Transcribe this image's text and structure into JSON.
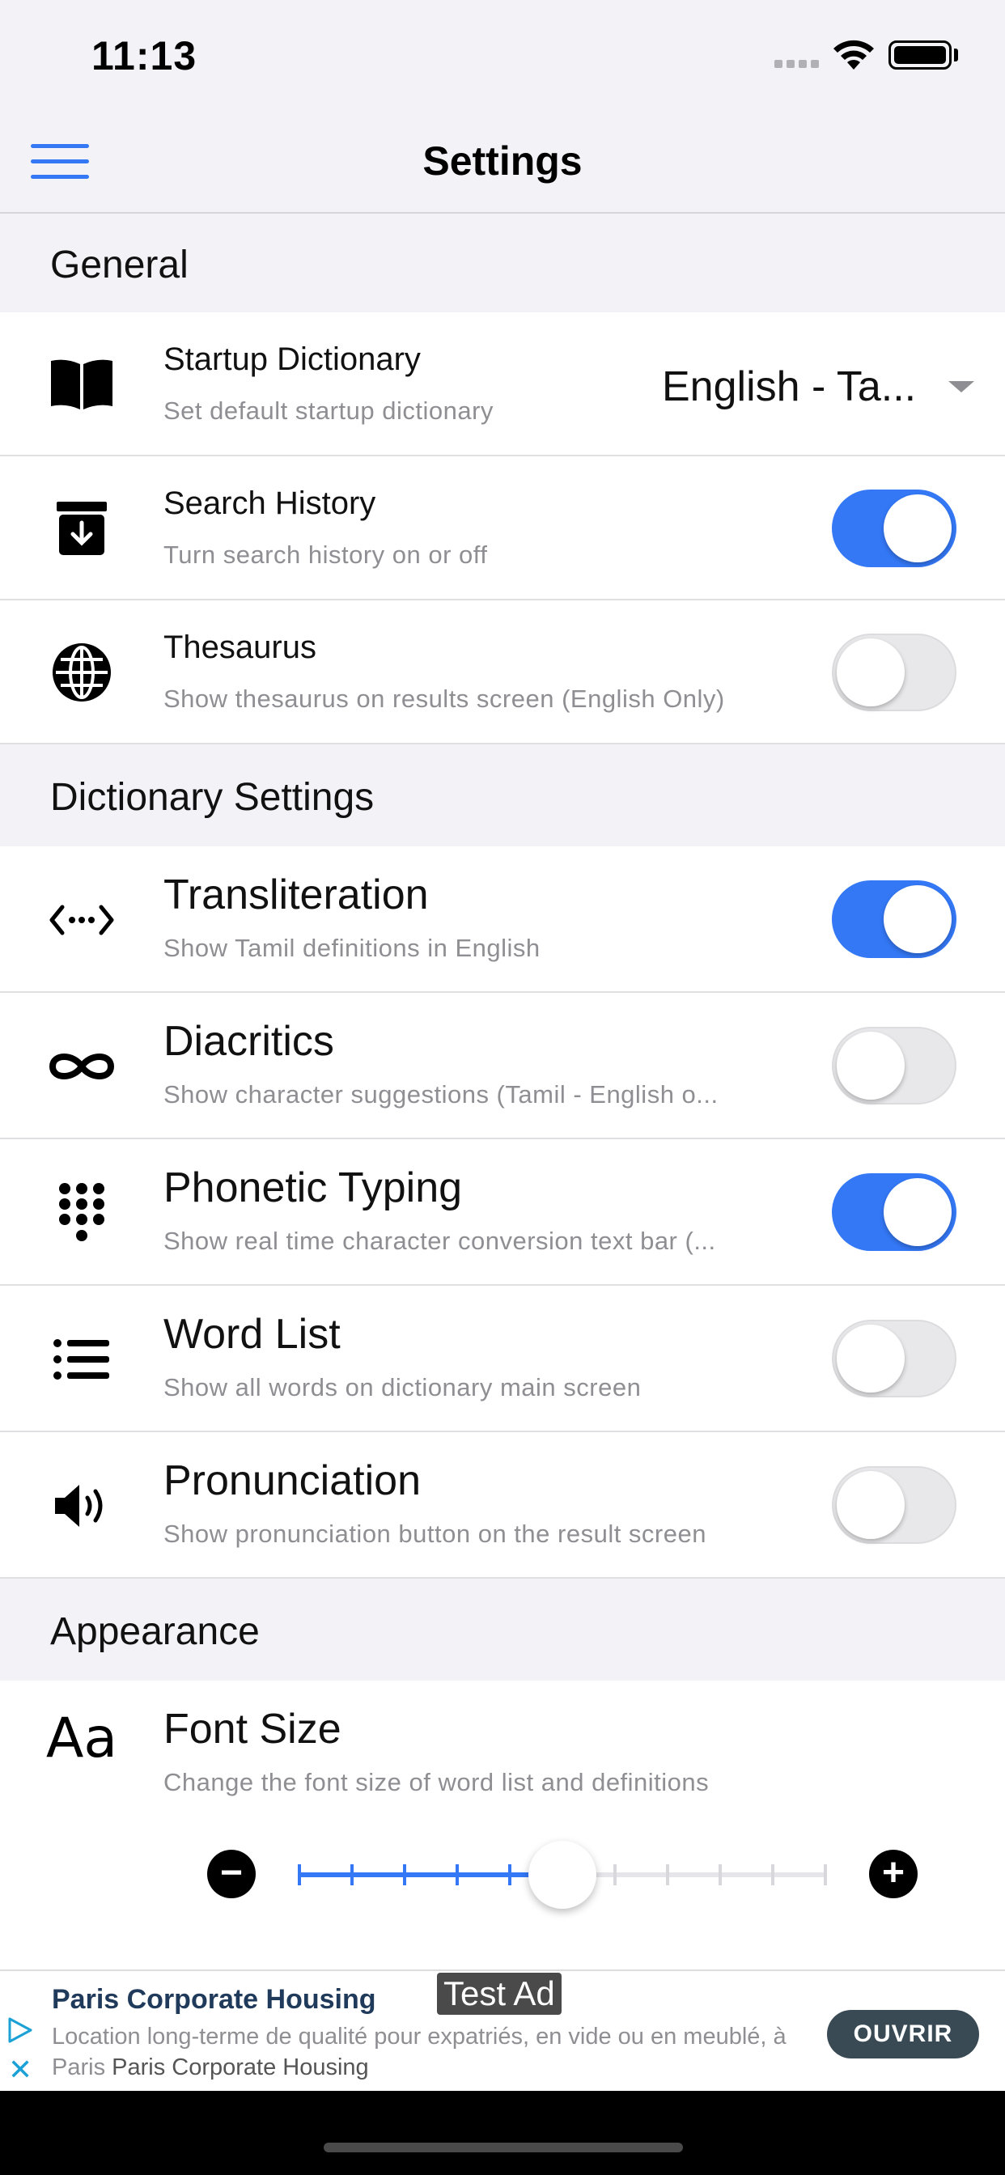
{
  "status_bar": {
    "time": "11:13"
  },
  "nav": {
    "title": "Settings"
  },
  "sections": {
    "general": "General",
    "dictionary": "Dictionary Settings",
    "appearance": "Appearance"
  },
  "general": {
    "startup": {
      "title": "Startup Dictionary",
      "subtitle": "Set default startup dictionary",
      "value": "English - Ta..."
    },
    "history": {
      "title": "Search History",
      "subtitle": "Turn search history on or off",
      "enabled": true
    },
    "thesaurus": {
      "title": "Thesaurus",
      "subtitle": "Show thesaurus on results screen (English Only)",
      "enabled": false
    }
  },
  "dictionary": {
    "transliteration": {
      "title": "Transliteration",
      "subtitle": "Show Tamil definitions in English",
      "enabled": true
    },
    "diacritics": {
      "title": "Diacritics",
      "subtitle": "Show character suggestions (Tamil - English o...",
      "enabled": false
    },
    "phonetic": {
      "title": "Phonetic Typing",
      "subtitle": "Show real time character conversion text bar (...",
      "enabled": true
    },
    "wordlist": {
      "title": "Word List",
      "subtitle": "Show all words on dictionary main screen",
      "enabled": false
    },
    "pronunciation": {
      "title": "Pronunciation",
      "subtitle": "Show pronunciation button on the result screen",
      "enabled": false
    }
  },
  "appearance": {
    "font_size": {
      "title": "Font Size",
      "subtitle": "Change the font size of word list and definitions",
      "icon_text": "Aa",
      "minus": "−",
      "plus": "+",
      "level": 5,
      "steps": 10
    }
  },
  "ad": {
    "label": "Test Ad",
    "title": "Paris Corporate Housing",
    "body": "Location long-terme de qualité pour expatriés, en vide ou en meublé, à Paris",
    "advertiser": "Paris Corporate Housing",
    "cta": "OUVRIR",
    "close": "✕"
  },
  "colors": {
    "accent": "#3478f6",
    "background": "#f2f2f7"
  }
}
